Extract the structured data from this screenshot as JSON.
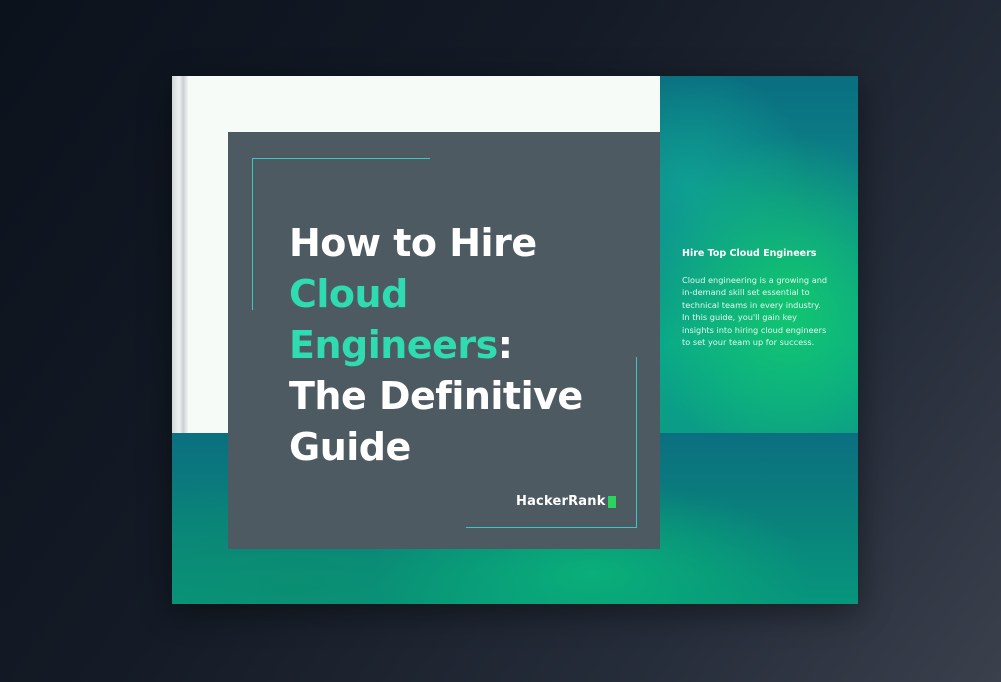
{
  "book": {
    "title_line1": "How to Hire",
    "title_line2": "Cloud",
    "title_line3_accent": "Engineers",
    "title_line3_colon": ":",
    "title_line4": "The Definitive",
    "title_line5": "Guide",
    "brand": "HackerRank",
    "side_heading": "Hire Top Cloud Engineers",
    "side_description": "Cloud engineering is a growing and in-demand skill set essential to technical teams in every industry. In this guide, you'll gain key insights into hiring cloud engineers to set your team up for success."
  },
  "colors": {
    "background": "#141b26",
    "cover": "#4e5a61",
    "accent": "#2fdcb1",
    "frame_lines": "#3ec6c6",
    "brand_block": "#2bd45f",
    "teal": "#0a7f7c"
  }
}
